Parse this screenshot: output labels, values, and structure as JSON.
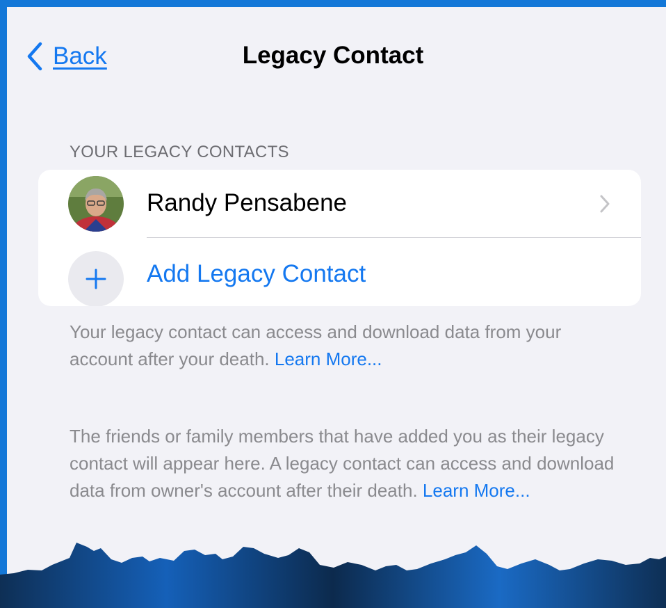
{
  "nav": {
    "back_label": "Back",
    "title": "Legacy Contact"
  },
  "section": {
    "header": "YOUR LEGACY CONTACTS"
  },
  "contacts": [
    {
      "name": "Randy Pensabene"
    }
  ],
  "add_contact": {
    "label": "Add Legacy Contact"
  },
  "footer": {
    "owner_text": "Your legacy contact can access and download data from your account after your death.",
    "owner_link": "Learn More...",
    "others_text": "The friends or family members that have added you as their legacy contact will appear here. A legacy contact can access and download data from owner's account after their death.",
    "others_link": "Learn More..."
  },
  "colors": {
    "accent": "#1478f0",
    "frame": "#1478d8",
    "background": "#f2f2f7"
  }
}
